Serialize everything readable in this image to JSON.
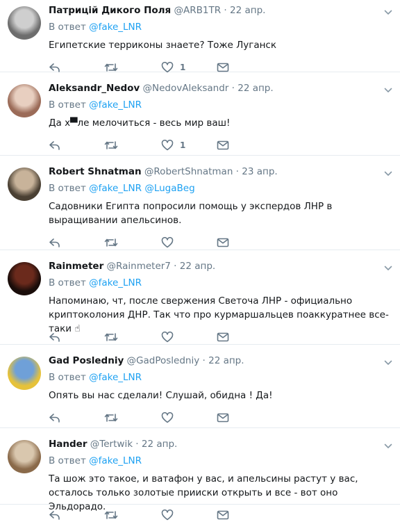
{
  "tweets": [
    {
      "name": "Патрицій Дикого Поля",
      "handle": "@ARB1TR",
      "time": "22 апр.",
      "reply_prefix": "В ответ",
      "mentions": [
        "@fake_LNR"
      ],
      "text": "Египетские терриконы знаете? Тоже Луганск",
      "likes": "1",
      "avatar_colors": [
        "#cfcfcf",
        "#6d6d6d"
      ]
    },
    {
      "name": "Aleksandr_Nedov",
      "handle": "@NedovAleksandr",
      "time": "22 апр.",
      "reply_prefix": "В ответ",
      "mentions": [
        "@fake_LNR"
      ],
      "text": "Да х▀ле мелочиться - весь мир ваш!",
      "likes": "1",
      "avatar_colors": [
        "#e8cfc0",
        "#9b6b58"
      ]
    },
    {
      "name": "Robert Shnatman",
      "handle": "@RobertShnatman",
      "time": "23 апр.",
      "reply_prefix": "В ответ",
      "mentions": [
        "@fake_LNR",
        "@LugaBeg"
      ],
      "text": "Садовники Египта попросили помощь у экспердов ЛНР в выращивании апельсинов.",
      "likes": "",
      "avatar_colors": [
        "#c8b39a",
        "#4a4033"
      ]
    },
    {
      "name": "Rainmeter",
      "handle": "@Rainmeter7",
      "time": "22 апр.",
      "reply_prefix": "В ответ",
      "mentions": [
        "@fake_LNR"
      ],
      "text": "Напоминаю, чт, после свержения Светоча ЛНР - официально криптоколония ДНР. Так что про курмаршальцев поаккуратнее все-таки ☝",
      "likes": "",
      "avatar_colors": [
        "#6b2a1c",
        "#1a0d0a"
      ]
    },
    {
      "name": "Gad Posledniy",
      "handle": "@GadPosledniy",
      "time": "22 апр.",
      "reply_prefix": "В ответ",
      "mentions": [
        "@fake_LNR"
      ],
      "text": "Опять вы нас сделали! Слушай, обидна ! Да!",
      "likes": "",
      "avatar_colors": [
        "#6fa0d8",
        "#e6c23a"
      ]
    },
    {
      "name": "Hander",
      "handle": "@Tertwik",
      "time": "22 апр.",
      "reply_prefix": "В ответ",
      "mentions": [
        "@fake_LNR"
      ],
      "text": "Та шож это такое, и ватафон у вас, и апельсины растут у  вас, осталось только золотые прииски открыть и все - вот оно Эльдорадо.",
      "likes": "",
      "avatar_colors": [
        "#d9c7ae",
        "#8a6a4a"
      ]
    }
  ],
  "colors": {
    "link": "#1da1f2",
    "muted": "#657786",
    "text": "#14171a",
    "divider": "#e6ecf0"
  },
  "icons": [
    "reply-icon",
    "retweet-icon",
    "like-icon",
    "dm-icon",
    "chevron-down-icon"
  ]
}
